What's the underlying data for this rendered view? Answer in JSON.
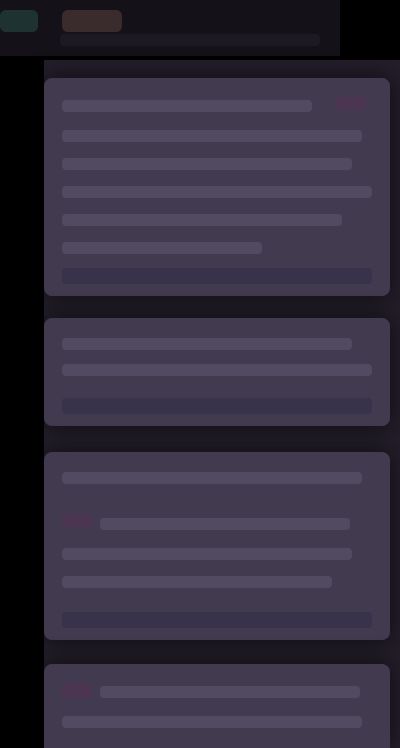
{
  "app": {
    "title": ""
  },
  "colors": {
    "page_background": "#000000",
    "top_bar": "#141218",
    "feed_background": "#231e2a",
    "card_background": "#423b4f",
    "card_text_placeholder": "#524a60",
    "accent_teal": "#1f3232",
    "accent_orange": "#3a2c2c",
    "accent_purple": "#4c3550"
  },
  "feed": {
    "posts": [
      {
        "body_text": "",
        "footer_text": ""
      },
      {
        "body_text": "",
        "footer_text": ""
      },
      {
        "body_text": "",
        "footer_text": ""
      },
      {
        "body_text": "",
        "footer_text": ""
      }
    ]
  }
}
